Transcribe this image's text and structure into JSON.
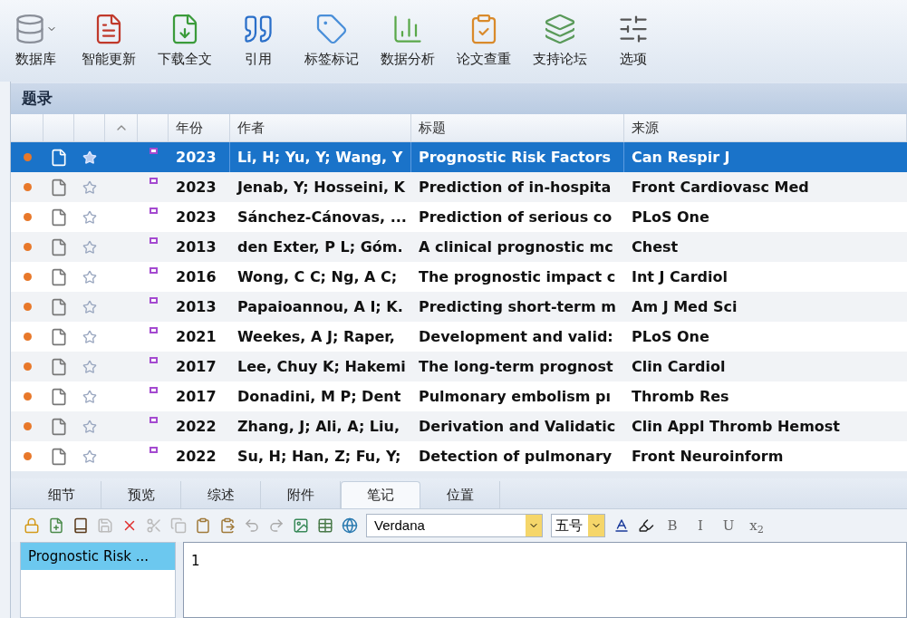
{
  "toolbar": [
    {
      "label": "数据库",
      "kind": "database",
      "dropdown": true
    },
    {
      "label": "智能更新",
      "kind": "update",
      "dropdown": false
    },
    {
      "label": "下载全文",
      "kind": "download",
      "dropdown": false
    },
    {
      "label": "引用",
      "kind": "cite",
      "dropdown": false
    },
    {
      "label": "标签标记",
      "kind": "tag",
      "dropdown": false
    },
    {
      "label": "数据分析",
      "kind": "chart",
      "dropdown": false
    },
    {
      "label": "论文查重",
      "kind": "check",
      "dropdown": false
    },
    {
      "label": "支持论坛",
      "kind": "forum",
      "dropdown": false
    },
    {
      "label": "选项",
      "kind": "options",
      "dropdown": false
    }
  ],
  "panel_title": "题录",
  "table": {
    "columns": [
      "年份",
      "作者",
      "标题",
      "来源"
    ],
    "rows": [
      {
        "year": "2023",
        "author": "Li, H; Yu, Y; Wang, Y",
        "title": "Prognostic Risk Factors",
        "source": "Can Respir J",
        "selected": true
      },
      {
        "year": "2023",
        "author": "Jenab, Y; Hosseini, K",
        "title": "Prediction of in-hospita",
        "source": "Front Cardiovasc Med",
        "selected": false
      },
      {
        "year": "2023",
        "author": "Sánchez-Cánovas, ...",
        "title": "Prediction of serious co",
        "source": "PLoS One",
        "selected": false
      },
      {
        "year": "2013",
        "author": "den Exter, P L; Góm.",
        "title": "A clinical prognostic mc",
        "source": "Chest",
        "selected": false
      },
      {
        "year": "2016",
        "author": "Wong, C C; Ng, A C;",
        "title": "The prognostic impact c",
        "source": "Int J Cardiol",
        "selected": false
      },
      {
        "year": "2013",
        "author": "Papaioannou, A I; K.",
        "title": "Predicting short-term m",
        "source": "Am J Med Sci",
        "selected": false
      },
      {
        "year": "2021",
        "author": "Weekes, A J; Raper,",
        "title": "Development and valid:",
        "source": "PLoS One",
        "selected": false
      },
      {
        "year": "2017",
        "author": "Lee, Chuy K; Hakemi",
        "title": "The long-term prognost",
        "source": "Clin Cardiol",
        "selected": false
      },
      {
        "year": "2017",
        "author": "Donadini, M P; Dent",
        "title": "Pulmonary embolism pı",
        "source": "Thromb Res",
        "selected": false
      },
      {
        "year": "2022",
        "author": "Zhang, J; Ali, A; Liu,",
        "title": "Derivation and Validatic",
        "source": "Clin Appl Thromb Hemost",
        "selected": false
      },
      {
        "year": "2022",
        "author": "Su, H; Han, Z; Fu, Y;",
        "title": "Detection of pulmonary",
        "source": "Front Neuroinform",
        "selected": false
      }
    ]
  },
  "tabs": [
    {
      "label": "细节",
      "selected": false
    },
    {
      "label": "预览",
      "selected": false
    },
    {
      "label": "综述",
      "selected": false
    },
    {
      "label": "附件",
      "selected": false
    },
    {
      "label": "笔记",
      "selected": true
    },
    {
      "label": "位置",
      "selected": false
    }
  ],
  "editor_toolbar": {
    "font": "Verdana",
    "size": "五号",
    "format_buttons": [
      "B",
      "I",
      "U",
      "x$_{2}$"
    ]
  },
  "notes": [
    {
      "label": "Prognostic Risk ...",
      "selected": true
    }
  ],
  "note_text": "1"
}
